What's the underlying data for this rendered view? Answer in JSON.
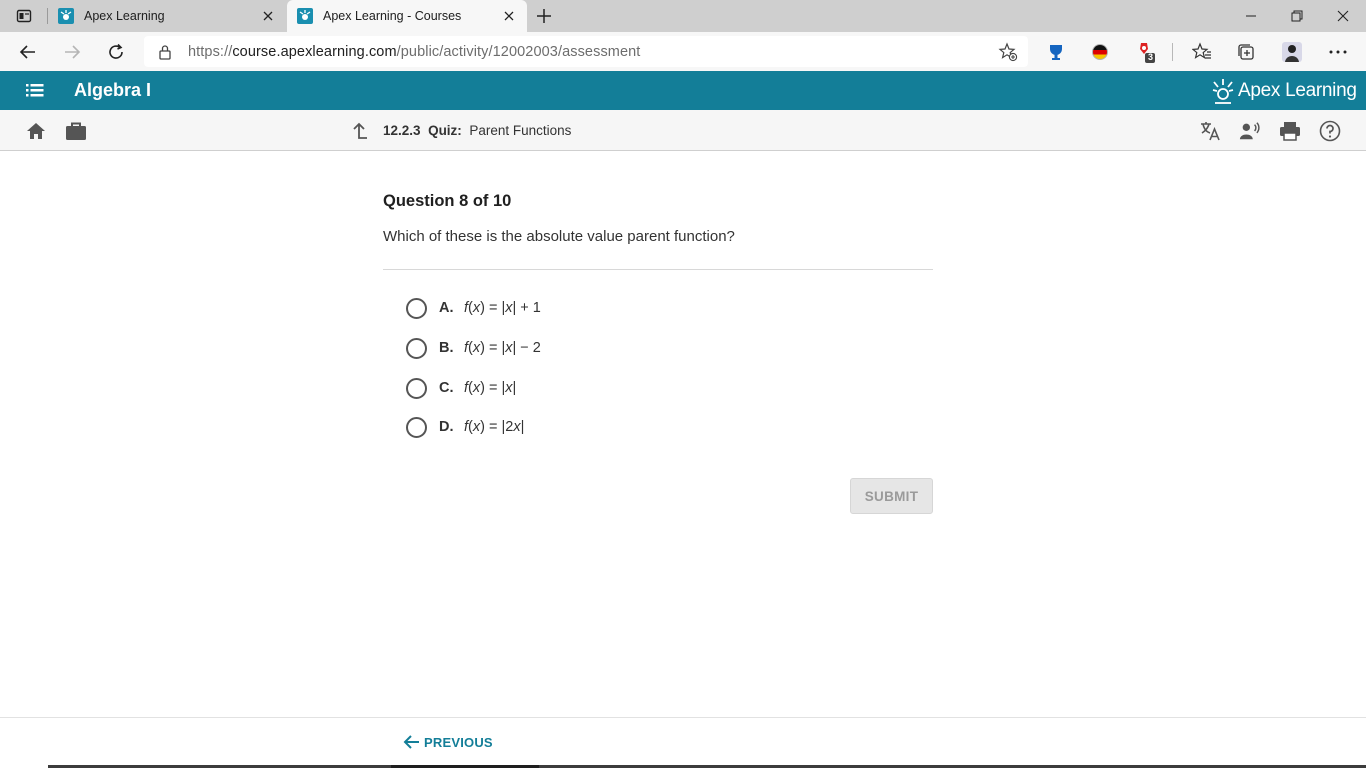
{
  "browser": {
    "tabs": [
      {
        "title": "Apex Learning",
        "active": false
      },
      {
        "title": "Apex Learning - Courses",
        "active": true
      }
    ],
    "url": {
      "scheme": "https://",
      "host": "course.apexlearning.com",
      "path": "/public/activity/12002003/assessment"
    },
    "extension_badge": "3"
  },
  "app": {
    "course_title": "Algebra I",
    "brand": "Apex Learning",
    "accent_color": "#137e98"
  },
  "breadcrumb": {
    "number": "12.2.3",
    "type": "Quiz:",
    "title": "Parent Functions"
  },
  "question": {
    "heading": "Question 8 of 10",
    "prompt": "Which of these is the absolute value parent function?",
    "choices": [
      {
        "letter": "A.",
        "f": "f",
        "x": "x",
        "rhs_pre": " = |",
        "var": "x",
        "rhs_post": "| + 1"
      },
      {
        "letter": "B.",
        "f": "f",
        "x": "x",
        "rhs_pre": " = |",
        "var": "x",
        "rhs_post": "| − 2"
      },
      {
        "letter": "C.",
        "f": "f",
        "x": "x",
        "rhs_pre": " = |",
        "var": "x",
        "rhs_post": "|"
      },
      {
        "letter": "D.",
        "f": "f",
        "x": "x",
        "rhs_pre": " = |2",
        "var": "x",
        "rhs_post": "|"
      }
    ],
    "submit_label": "SUBMIT"
  },
  "footer": {
    "previous_label": "PREVIOUS"
  }
}
